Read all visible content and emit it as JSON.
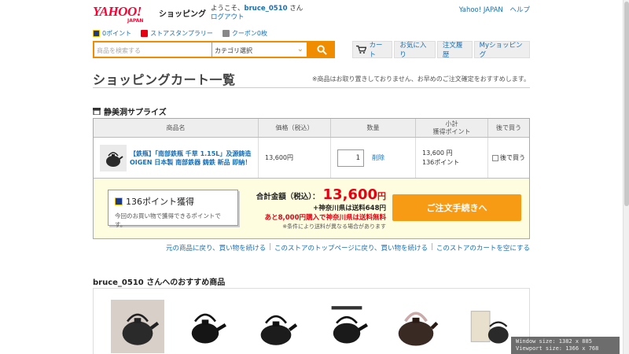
{
  "header": {
    "logo_text": "YAHOO!",
    "logo_sub": "JAPAN",
    "shop_title": "ショッピング",
    "welcome_prefix": "ようこそ、",
    "username": "bruce_0510",
    "welcome_suffix": " さん",
    "logout": "ログアウト",
    "yahoo_japan": "Yahoo! JAPAN",
    "help": "ヘルプ"
  },
  "subbar": {
    "points": "0ポイント",
    "stamp_rally": "ストアスタンプラリー",
    "coupon": "クーポン0枚"
  },
  "search": {
    "placeholder": "商品を検索する",
    "category": "カテゴリ選択"
  },
  "nav": {
    "cart": "カート",
    "favorites": "お気に入り",
    "history": "注文履歴",
    "myshopping": "Myショッピング"
  },
  "page": {
    "title": "ショッピングカート一覧",
    "notice": "※商品はお取り置きしておりません、お早めのご注文確定をおすすめします。"
  },
  "store": {
    "name": "静美洞サプライズ"
  },
  "table": {
    "headers": {
      "product": "商品名",
      "price": "価格（税込）",
      "qty": "数量",
      "subtotal_line1": "小計",
      "subtotal_line2": "獲得ポイント",
      "later": "後で買う"
    },
    "item": {
      "name": "【鉄瓶】「南部鉄瓶 千草 1.15L」及源鋳造 OIGEN 日本製 南部鉄器 鋳鉄 新品 即納！",
      "price": "13,600円",
      "qty": "1",
      "delete": "削除",
      "subtotal": "13,600 円",
      "points": "136ポイント",
      "later_label": "後で買う"
    }
  },
  "summary": {
    "points_earned": "136ポイント獲得",
    "points_note": "今回のお買い物で獲得できるポイントです。",
    "total_label": "合計金額（税込）：",
    "total_value": "13,600",
    "total_unit": "円",
    "shipping": "+神奈川県は送料648円",
    "free_shipping": "あと8,000円購入で神奈川県は送料無料",
    "condition": "※条件により送料が異なる場合があります",
    "order_button": "ご注文手続きへ"
  },
  "links": {
    "back": "元の商品に戻り、買い物を続ける",
    "store_top": "このストアのトップページに戻り、買い物を続ける",
    "empty_cart": "このストアのカートを空にする"
  },
  "recommend": {
    "title": "bruce_0510 さんへのおすすめ商品"
  },
  "overlay": {
    "window_size": "Window size: 1382 x 885",
    "viewport_size": "Viewport size: 1366 x 768"
  },
  "colors": {
    "accent_orange": "#f08c00",
    "price_red": "#e60012",
    "link_blue": "#1a6fb5",
    "yahoo_red": "#ff0033"
  }
}
